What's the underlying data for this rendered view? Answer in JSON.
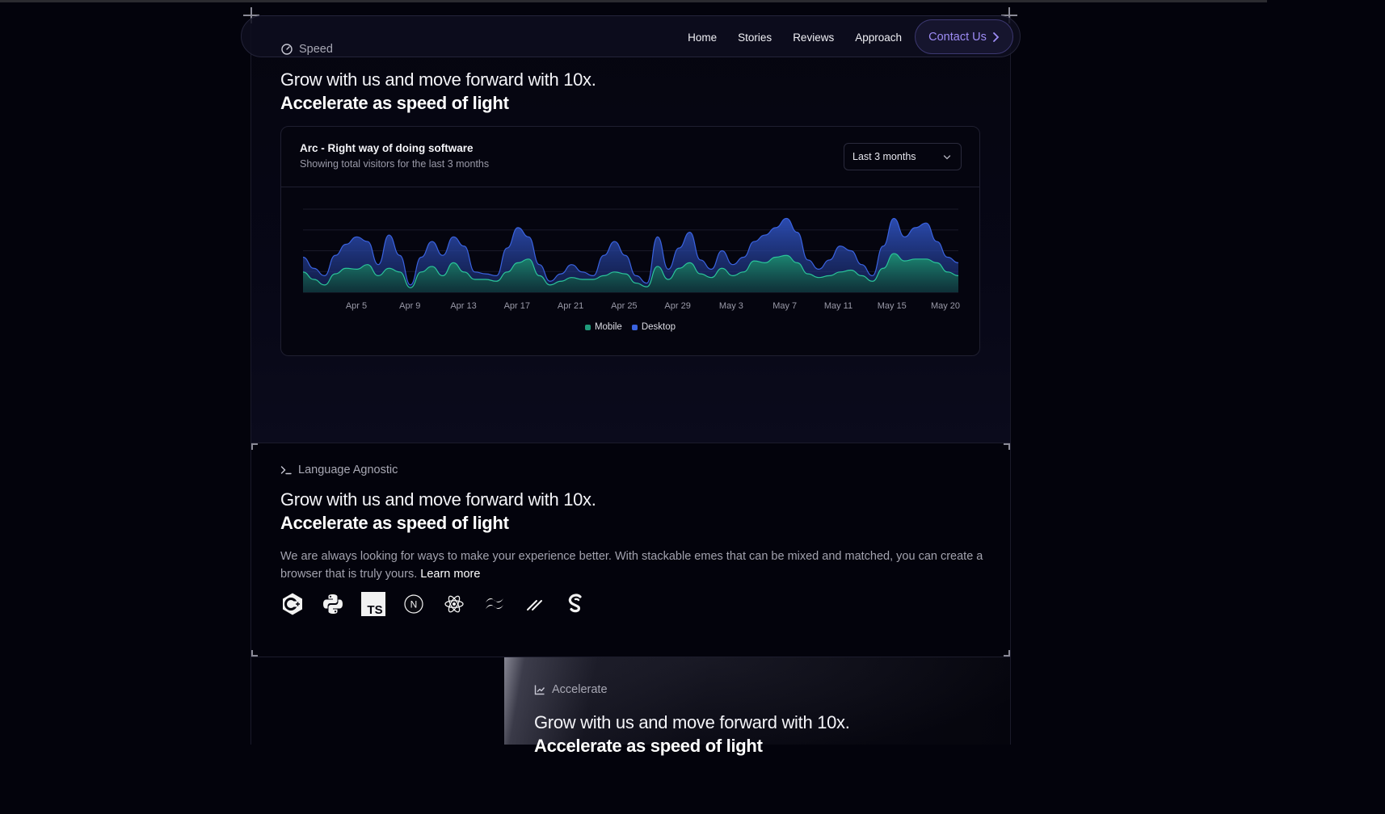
{
  "nav": {
    "links": [
      "Home",
      "Stories",
      "Reviews",
      "Approach"
    ],
    "contact_label": "Contact Us"
  },
  "speed_section": {
    "eyebrow": "Speed",
    "headline": "Grow with us and move forward with 10x.",
    "headline_bold": "Accelerate as speed of light"
  },
  "chart_card": {
    "title": "Arc - Right way of doing software",
    "subtitle": "Showing total visitors for the last 3 months",
    "range_select": "Last 3 months"
  },
  "chart_data": {
    "type": "area",
    "x_tick_labels": [
      "Apr 5",
      "Apr 9",
      "Apr 13",
      "Apr 17",
      "Apr 21",
      "Apr 25",
      "Apr 29",
      "May 3",
      "May 7",
      "May 11",
      "May 15",
      "May 20"
    ],
    "legend": [
      "Mobile",
      "Desktop"
    ],
    "grid": true,
    "legend_position": "bottom",
    "series": [
      {
        "name": "Desktop",
        "color": "#2b4aa8",
        "values": [
          38,
          26,
          18,
          40,
          52,
          60,
          55,
          30,
          62,
          40,
          8,
          38,
          55,
          40,
          60,
          50,
          22,
          20,
          18,
          48,
          70,
          60,
          30,
          12,
          20,
          30,
          22,
          18,
          40,
          55,
          40,
          18,
          10,
          60,
          25,
          48,
          65,
          35,
          25,
          45,
          30,
          38,
          55,
          62,
          70,
          80,
          65,
          35,
          25,
          35,
          50,
          45,
          30,
          18,
          50,
          80,
          60,
          70,
          75,
          55,
          38,
          32
        ]
      },
      {
        "name": "Mobile",
        "color": "#1f9b7a",
        "values": [
          22,
          14,
          8,
          20,
          26,
          25,
          30,
          18,
          26,
          22,
          5,
          22,
          28,
          18,
          32,
          22,
          14,
          14,
          12,
          22,
          32,
          36,
          18,
          8,
          12,
          16,
          14,
          14,
          18,
          22,
          20,
          10,
          6,
          28,
          14,
          26,
          32,
          20,
          16,
          26,
          18,
          22,
          34,
          32,
          38,
          40,
          32,
          20,
          16,
          18,
          22,
          24,
          18,
          12,
          26,
          42,
          34,
          36,
          36,
          32,
          22,
          18
        ]
      }
    ]
  },
  "lang_section": {
    "eyebrow": "Language Agnostic",
    "headline": "Grow with us and move forward with 10x.",
    "headline_bold": "Accelerate as speed of light",
    "paragraph": "We are always looking for ways to make your experience better. With stackable emes that can be mixed and matched, you can create a browser that is truly yours.",
    "link": "Learn more",
    "logos": [
      "cplusplus-icon",
      "python-icon",
      "typescript-icon",
      "nextjs-icon",
      "react-icon",
      "tailwind-icon",
      "slash-icon",
      "svelte-icon"
    ],
    "ts_label": "TS",
    "next_label": "N"
  },
  "accelerate_section": {
    "eyebrow": "Accelerate",
    "headline": "Grow with us and move forward with 10x.",
    "headline_bold": "Accelerate as speed of light"
  },
  "colors": {
    "background": "#03030c",
    "accent": "#9d8cf5",
    "mobile": "#1f9b7a",
    "desktop": "#2b4aa8"
  }
}
